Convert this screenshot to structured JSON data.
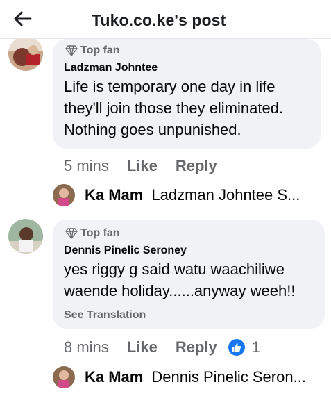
{
  "header": {
    "title": "Tuko.co.ke's post"
  },
  "comments": [
    {
      "badge": "Top fan",
      "author": "Ladzman Johntee",
      "lines": [
        "Life is temporary one day in life",
        "they'll join those they eliminated.",
        "Nothing goes unpunished."
      ],
      "time": "5 mins",
      "like": "Like",
      "reply": "Reply",
      "reply_preview": {
        "name": "Ka Mam",
        "text": "Ladzman Johntee  S..."
      }
    },
    {
      "badge": "Top fan",
      "author": "Dennis Pinelic Seroney",
      "lines": [
        "yes riggy g said watu waachiliwe",
        "waende holiday......anyway weeh!!"
      ],
      "see_translation": "See Translation",
      "time": "8 mins",
      "like": "Like",
      "reply": "Reply",
      "reaction_count": "1",
      "reply_preview": {
        "name": "Ka Mam",
        "text": "Dennis Pinelic Seron..."
      }
    }
  ],
  "icons": {
    "back": "arrow-left-icon",
    "badge": "diamond-icon",
    "reaction": "thumbs-up-icon"
  },
  "colors": {
    "like_blue": "#1877f2",
    "bubble": "#f0f2f5",
    "secondary_text": "#65676b"
  }
}
